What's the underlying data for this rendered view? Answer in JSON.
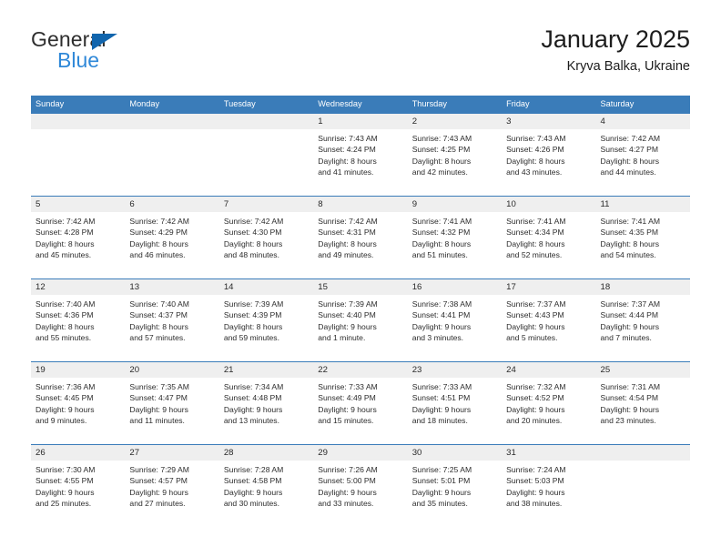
{
  "brand": {
    "name_dark": "General",
    "name_blue": "Blue",
    "accent_blue": "#2f88d8",
    "triangle_blue": "#1165ad"
  },
  "header": {
    "title": "January 2025",
    "location": "Kryva Balka, Ukraine",
    "header_bar_color": "#3a7cb9",
    "daynum_band_color": "#efefef"
  },
  "weekdays": [
    "Sunday",
    "Monday",
    "Tuesday",
    "Wednesday",
    "Thursday",
    "Friday",
    "Saturday"
  ],
  "weeks": [
    [
      {
        "day": "",
        "sunrise": "",
        "sunset": "",
        "daylight1": "",
        "daylight2": ""
      },
      {
        "day": "",
        "sunrise": "",
        "sunset": "",
        "daylight1": "",
        "daylight2": ""
      },
      {
        "day": "",
        "sunrise": "",
        "sunset": "",
        "daylight1": "",
        "daylight2": ""
      },
      {
        "day": "1",
        "sunrise": "Sunrise: 7:43 AM",
        "sunset": "Sunset: 4:24 PM",
        "daylight1": "Daylight: 8 hours",
        "daylight2": "and 41 minutes."
      },
      {
        "day": "2",
        "sunrise": "Sunrise: 7:43 AM",
        "sunset": "Sunset: 4:25 PM",
        "daylight1": "Daylight: 8 hours",
        "daylight2": "and 42 minutes."
      },
      {
        "day": "3",
        "sunrise": "Sunrise: 7:43 AM",
        "sunset": "Sunset: 4:26 PM",
        "daylight1": "Daylight: 8 hours",
        "daylight2": "and 43 minutes."
      },
      {
        "day": "4",
        "sunrise": "Sunrise: 7:42 AM",
        "sunset": "Sunset: 4:27 PM",
        "daylight1": "Daylight: 8 hours",
        "daylight2": "and 44 minutes."
      }
    ],
    [
      {
        "day": "5",
        "sunrise": "Sunrise: 7:42 AM",
        "sunset": "Sunset: 4:28 PM",
        "daylight1": "Daylight: 8 hours",
        "daylight2": "and 45 minutes."
      },
      {
        "day": "6",
        "sunrise": "Sunrise: 7:42 AM",
        "sunset": "Sunset: 4:29 PM",
        "daylight1": "Daylight: 8 hours",
        "daylight2": "and 46 minutes."
      },
      {
        "day": "7",
        "sunrise": "Sunrise: 7:42 AM",
        "sunset": "Sunset: 4:30 PM",
        "daylight1": "Daylight: 8 hours",
        "daylight2": "and 48 minutes."
      },
      {
        "day": "8",
        "sunrise": "Sunrise: 7:42 AM",
        "sunset": "Sunset: 4:31 PM",
        "daylight1": "Daylight: 8 hours",
        "daylight2": "and 49 minutes."
      },
      {
        "day": "9",
        "sunrise": "Sunrise: 7:41 AM",
        "sunset": "Sunset: 4:32 PM",
        "daylight1": "Daylight: 8 hours",
        "daylight2": "and 51 minutes."
      },
      {
        "day": "10",
        "sunrise": "Sunrise: 7:41 AM",
        "sunset": "Sunset: 4:34 PM",
        "daylight1": "Daylight: 8 hours",
        "daylight2": "and 52 minutes."
      },
      {
        "day": "11",
        "sunrise": "Sunrise: 7:41 AM",
        "sunset": "Sunset: 4:35 PM",
        "daylight1": "Daylight: 8 hours",
        "daylight2": "and 54 minutes."
      }
    ],
    [
      {
        "day": "12",
        "sunrise": "Sunrise: 7:40 AM",
        "sunset": "Sunset: 4:36 PM",
        "daylight1": "Daylight: 8 hours",
        "daylight2": "and 55 minutes."
      },
      {
        "day": "13",
        "sunrise": "Sunrise: 7:40 AM",
        "sunset": "Sunset: 4:37 PM",
        "daylight1": "Daylight: 8 hours",
        "daylight2": "and 57 minutes."
      },
      {
        "day": "14",
        "sunrise": "Sunrise: 7:39 AM",
        "sunset": "Sunset: 4:39 PM",
        "daylight1": "Daylight: 8 hours",
        "daylight2": "and 59 minutes."
      },
      {
        "day": "15",
        "sunrise": "Sunrise: 7:39 AM",
        "sunset": "Sunset: 4:40 PM",
        "daylight1": "Daylight: 9 hours",
        "daylight2": "and 1 minute."
      },
      {
        "day": "16",
        "sunrise": "Sunrise: 7:38 AM",
        "sunset": "Sunset: 4:41 PM",
        "daylight1": "Daylight: 9 hours",
        "daylight2": "and 3 minutes."
      },
      {
        "day": "17",
        "sunrise": "Sunrise: 7:37 AM",
        "sunset": "Sunset: 4:43 PM",
        "daylight1": "Daylight: 9 hours",
        "daylight2": "and 5 minutes."
      },
      {
        "day": "18",
        "sunrise": "Sunrise: 7:37 AM",
        "sunset": "Sunset: 4:44 PM",
        "daylight1": "Daylight: 9 hours",
        "daylight2": "and 7 minutes."
      }
    ],
    [
      {
        "day": "19",
        "sunrise": "Sunrise: 7:36 AM",
        "sunset": "Sunset: 4:45 PM",
        "daylight1": "Daylight: 9 hours",
        "daylight2": "and 9 minutes."
      },
      {
        "day": "20",
        "sunrise": "Sunrise: 7:35 AM",
        "sunset": "Sunset: 4:47 PM",
        "daylight1": "Daylight: 9 hours",
        "daylight2": "and 11 minutes."
      },
      {
        "day": "21",
        "sunrise": "Sunrise: 7:34 AM",
        "sunset": "Sunset: 4:48 PM",
        "daylight1": "Daylight: 9 hours",
        "daylight2": "and 13 minutes."
      },
      {
        "day": "22",
        "sunrise": "Sunrise: 7:33 AM",
        "sunset": "Sunset: 4:49 PM",
        "daylight1": "Daylight: 9 hours",
        "daylight2": "and 15 minutes."
      },
      {
        "day": "23",
        "sunrise": "Sunrise: 7:33 AM",
        "sunset": "Sunset: 4:51 PM",
        "daylight1": "Daylight: 9 hours",
        "daylight2": "and 18 minutes."
      },
      {
        "day": "24",
        "sunrise": "Sunrise: 7:32 AM",
        "sunset": "Sunset: 4:52 PM",
        "daylight1": "Daylight: 9 hours",
        "daylight2": "and 20 minutes."
      },
      {
        "day": "25",
        "sunrise": "Sunrise: 7:31 AM",
        "sunset": "Sunset: 4:54 PM",
        "daylight1": "Daylight: 9 hours",
        "daylight2": "and 23 minutes."
      }
    ],
    [
      {
        "day": "26",
        "sunrise": "Sunrise: 7:30 AM",
        "sunset": "Sunset: 4:55 PM",
        "daylight1": "Daylight: 9 hours",
        "daylight2": "and 25 minutes."
      },
      {
        "day": "27",
        "sunrise": "Sunrise: 7:29 AM",
        "sunset": "Sunset: 4:57 PM",
        "daylight1": "Daylight: 9 hours",
        "daylight2": "and 27 minutes."
      },
      {
        "day": "28",
        "sunrise": "Sunrise: 7:28 AM",
        "sunset": "Sunset: 4:58 PM",
        "daylight1": "Daylight: 9 hours",
        "daylight2": "and 30 minutes."
      },
      {
        "day": "29",
        "sunrise": "Sunrise: 7:26 AM",
        "sunset": "Sunset: 5:00 PM",
        "daylight1": "Daylight: 9 hours",
        "daylight2": "and 33 minutes."
      },
      {
        "day": "30",
        "sunrise": "Sunrise: 7:25 AM",
        "sunset": "Sunset: 5:01 PM",
        "daylight1": "Daylight: 9 hours",
        "daylight2": "and 35 minutes."
      },
      {
        "day": "31",
        "sunrise": "Sunrise: 7:24 AM",
        "sunset": "Sunset: 5:03 PM",
        "daylight1": "Daylight: 9 hours",
        "daylight2": "and 38 minutes."
      },
      {
        "day": "",
        "sunrise": "",
        "sunset": "",
        "daylight1": "",
        "daylight2": ""
      }
    ]
  ]
}
